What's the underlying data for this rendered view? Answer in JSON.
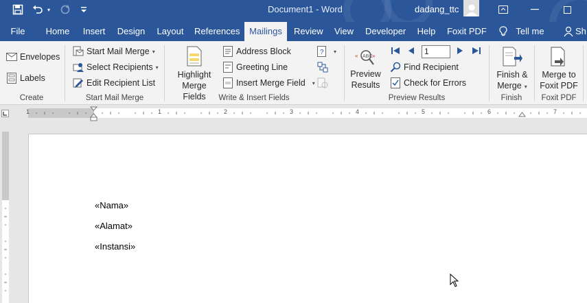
{
  "window": {
    "doc_title": "Document1  -  Word",
    "user_name": "dadang_ttc",
    "accent_color": "#2b579a"
  },
  "quick_access": {
    "icons": [
      "save-icon",
      "undo-icon",
      "redo-icon",
      "customize-icon"
    ]
  },
  "tabs": [
    {
      "label": "File"
    },
    {
      "label": "Home"
    },
    {
      "label": "Insert"
    },
    {
      "label": "Design"
    },
    {
      "label": "Layout"
    },
    {
      "label": "References"
    },
    {
      "label": "Mailings"
    },
    {
      "label": "Review"
    },
    {
      "label": "View"
    },
    {
      "label": "Developer"
    },
    {
      "label": "Help"
    },
    {
      "label": "Foxit PDF"
    },
    {
      "label": "Tell me"
    },
    {
      "label": "Sh"
    }
  ],
  "active_tab": "Mailings",
  "ribbon": {
    "create": {
      "envelopes": "Envelopes",
      "labels": "Labels",
      "group": "Create"
    },
    "start_mail_merge": {
      "start": "Start Mail Merge",
      "select": "Select Recipients",
      "edit": "Edit Recipient List",
      "group": "Start Mail Merge"
    },
    "write_insert": {
      "highlight_l1": "Highlight",
      "highlight_l2": "Merge Fields",
      "address": "Address Block",
      "greeting": "Greeting Line",
      "insert_field": "Insert Merge Field",
      "group": "Write & Insert Fields"
    },
    "preview": {
      "preview_l1": "Preview",
      "preview_l2": "Results",
      "record": "1",
      "find": "Find Recipient",
      "check": "Check for Errors",
      "group": "Preview Results"
    },
    "finish": {
      "finish_l1": "Finish &",
      "finish_l2": "Merge",
      "group": "Finish"
    },
    "foxit": {
      "merge_l1": "Merge to",
      "merge_l2": "Foxit PDF",
      "group": "Foxit PDF"
    }
  },
  "ruler": {
    "numbers": [
      "1",
      "1",
      "2",
      "3",
      "4",
      "5",
      "6",
      "7"
    ]
  },
  "document": {
    "fields": [
      "«Nama»",
      "«Alamat»",
      "«Instansi»"
    ]
  }
}
